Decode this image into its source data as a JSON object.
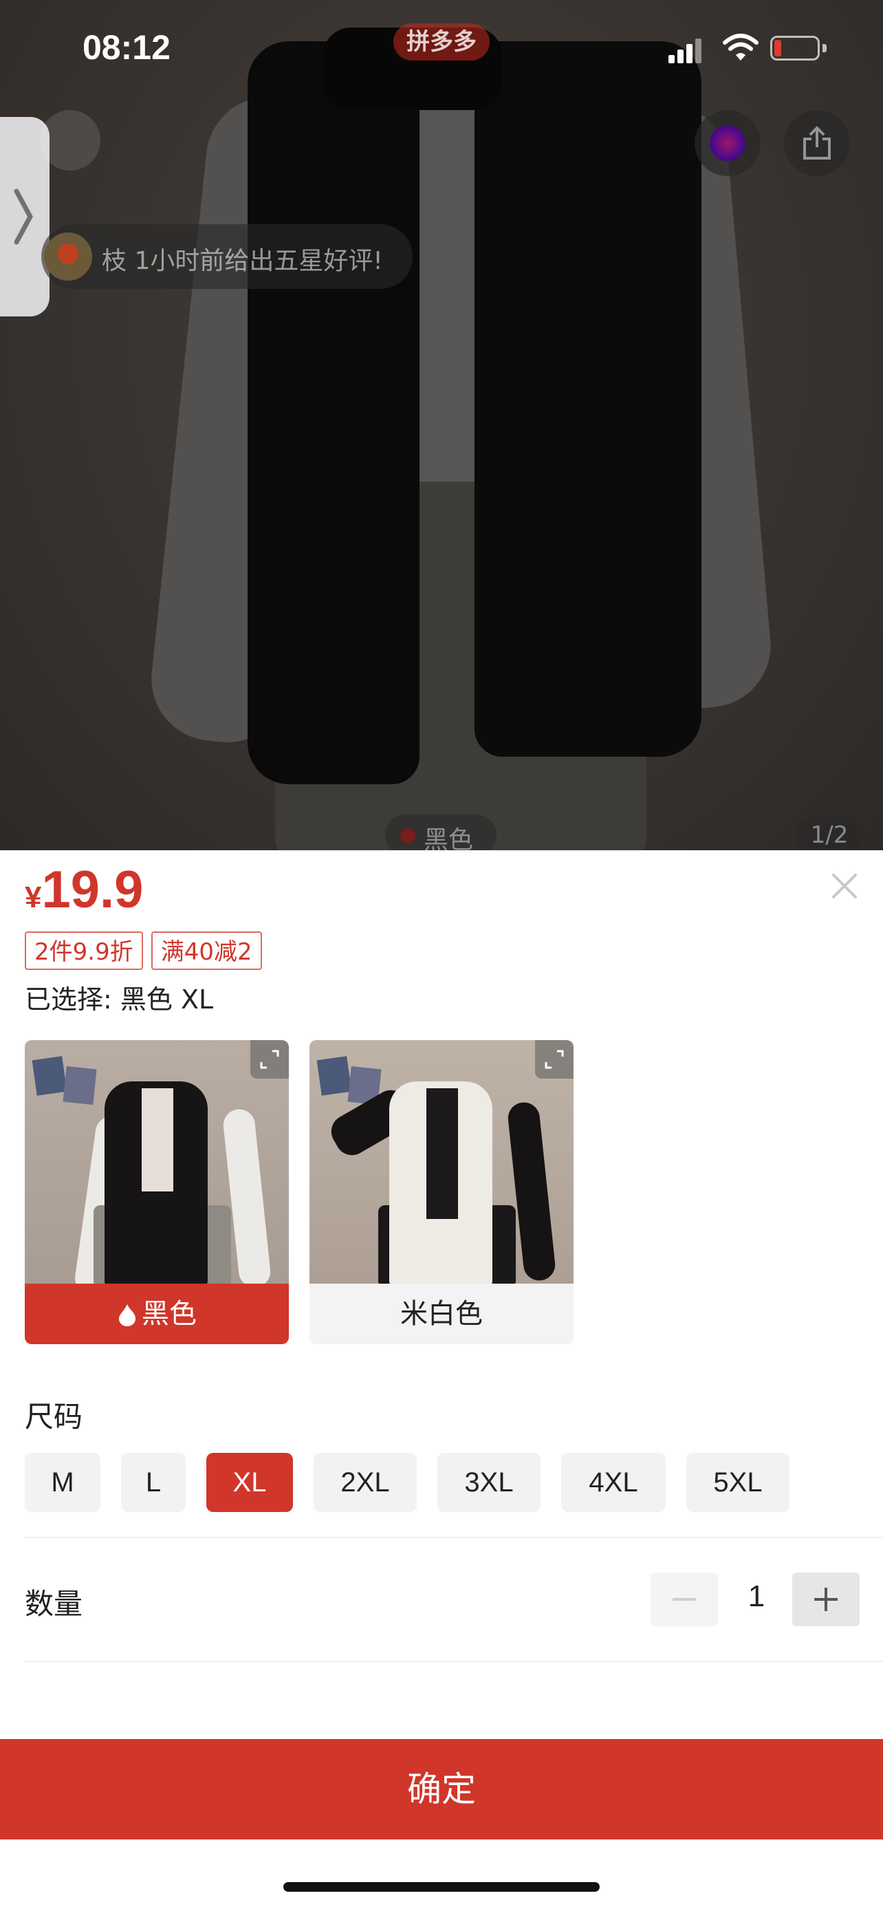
{
  "status_bar": {
    "time": "08:12",
    "app_badge": "拼多多"
  },
  "hero": {
    "review_ticker": "枝 1小时前给出五星好评!",
    "color_label": "黑色",
    "pager": "1/2"
  },
  "sheet": {
    "currency": "¥",
    "price": "19.9",
    "promo_tags": [
      "2件9.9折",
      "满40减2"
    ],
    "selected_text": "已选择: 黑色 XL",
    "colors": [
      {
        "label": "黑色",
        "selected": true,
        "hot": true
      },
      {
        "label": "米白色",
        "selected": false,
        "hot": false
      }
    ],
    "size_title": "尺码",
    "sizes": [
      "M",
      "L",
      "XL",
      "2XL",
      "3XL",
      "4XL",
      "5XL"
    ],
    "selected_size": "XL",
    "quantity_title": "数量",
    "quantity": "1",
    "confirm_label": "确定"
  },
  "colors": {
    "accent": "#d0362a",
    "option_bg": "#f2f2f2"
  },
  "icons": [
    "chevron-right-icon",
    "back-icon",
    "share-icon",
    "close-icon",
    "expand-icon",
    "flame-icon",
    "minus-icon",
    "plus-icon"
  ]
}
